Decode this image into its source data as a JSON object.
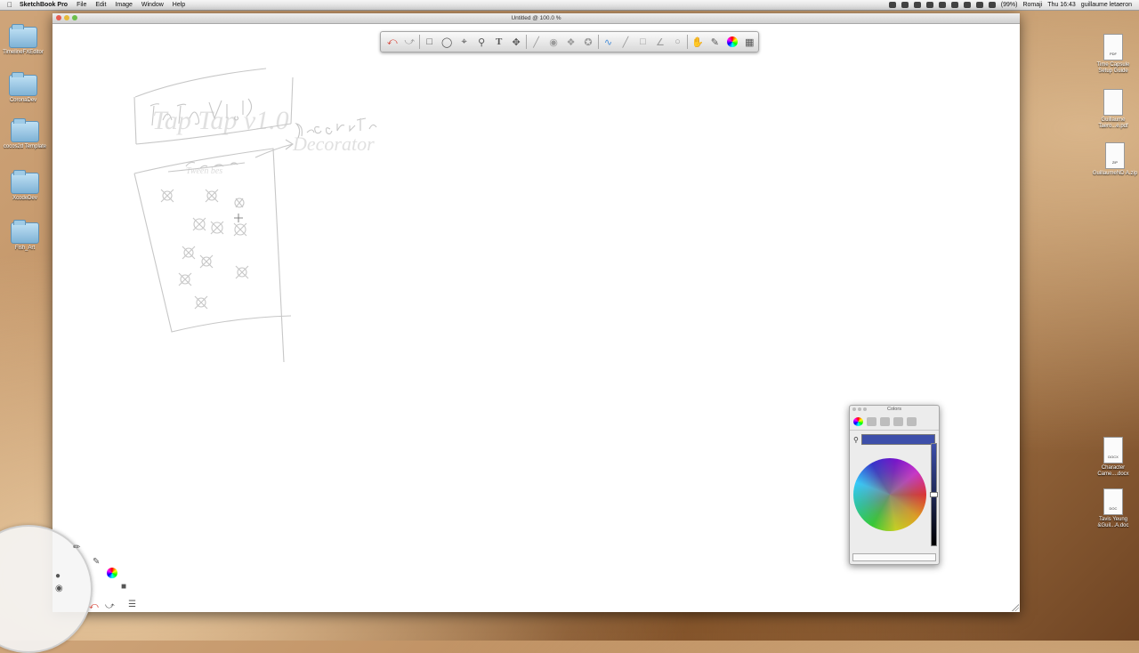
{
  "menubar": {
    "app_name": "SketchBook Pro",
    "menus": [
      "File",
      "Edit",
      "Image",
      "Window",
      "Help"
    ],
    "battery": "(99%)",
    "input_source": "Romaji",
    "clock": "Thu 16:43",
    "user": "guillaume letaeron"
  },
  "desktop": {
    "left_items": [
      "TimelineFXEditor",
      "CoronaDev",
      "cocos2d Template",
      "XcodeDev",
      "Fish_Art"
    ],
    "right_items": [
      {
        "label": "Time Capsule Setup Guide",
        "tag": "PDF"
      },
      {
        "label": "Guillaume Taero...e.pdf",
        "tag": ""
      },
      {
        "label": "GuillaumeND A.zip",
        "tag": "ZIP"
      },
      {
        "label": "Character Came....docx",
        "tag": "DOCX"
      },
      {
        "label": "Tavis Yeung &Guil...A.doc",
        "tag": "DOC"
      }
    ]
  },
  "window": {
    "title": "Untitled @ 100.0 %"
  },
  "toolbar": {
    "tools": [
      "undo-icon",
      "redo-icon",
      "select-rect-icon",
      "lasso-icon",
      "crop-icon",
      "zoom-icon",
      "text-icon",
      "move-icon",
      "ruler-icon",
      "ellipse-guide-icon",
      "symmetry-x-icon",
      "symmetry-y-icon",
      "line-stroke-icon",
      "line-icon",
      "rect-icon",
      "polyline-icon",
      "circle-icon",
      "hand-icon",
      "brushes-icon",
      "color-wheel-icon",
      "layers-icon"
    ]
  },
  "sketch": {
    "title_text": "Tap Tap v1.0",
    "side_text": "Decorator",
    "inner_text": "Tween bes"
  },
  "colors_panel": {
    "title": "Colors",
    "current_color": "#3d4faa"
  }
}
